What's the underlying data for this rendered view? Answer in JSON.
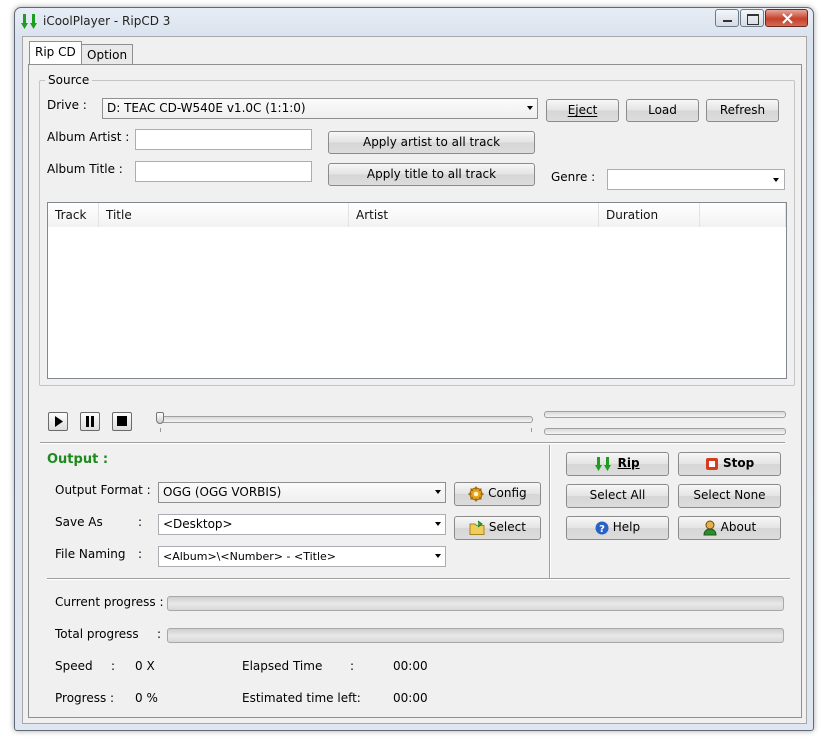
{
  "window": {
    "title": "iCoolPlayer - RipCD 3"
  },
  "tabs": [
    {
      "label": "Rip CD",
      "active": true
    },
    {
      "label": "Option",
      "active": false
    }
  ],
  "source": {
    "group_label": "Source",
    "drive_label": "Drive :",
    "drive_value": "D: TEAC CD-W540E v1.0C (1:1:0)",
    "eject_label": "Eject",
    "load_label": "Load",
    "refresh_label": "Refresh",
    "album_artist_label": "Album Artist :",
    "album_artist_value": "",
    "album_title_label": "Album Title :",
    "album_title_value": "",
    "apply_artist_label": "Apply artist to all track",
    "apply_title_label": "Apply title to all track",
    "genre_label": "Genre :",
    "genre_value": ""
  },
  "track_table": {
    "columns": [
      "Track",
      "Title",
      "Artist",
      "Duration"
    ],
    "rows": []
  },
  "output": {
    "heading": "Output :",
    "format_label": "Output Format :",
    "format_value": "OGG (OGG VORBIS)",
    "config_label": "Config",
    "save_as_label": "Save As",
    "save_as_value": "<Desktop>",
    "select_label": "Select",
    "file_naming_label": "File Naming",
    "file_naming_value": "<Album>\\<Number> - <Title>",
    "colon": ":"
  },
  "actions": {
    "rip": "Rip",
    "stop": "Stop",
    "select_all": "Select All",
    "select_none": "Select None",
    "help": "Help",
    "about": "About"
  },
  "status": {
    "current_progress_label": "Current progress :",
    "total_progress_label": "Total progress",
    "total_colon": ":",
    "speed_label": "Speed",
    "speed_colon": ":",
    "speed_value": "0 X",
    "elapsed_label": "Elapsed Time",
    "elapsed_colon": ":",
    "elapsed_value": "00:00",
    "progress_label": "Progress :",
    "progress_value": "0 %",
    "estimated_label": "Estimated time left:",
    "estimated_value": "00:00",
    "current_progress_fraction": 0,
    "total_progress_fraction": 0
  },
  "colors": {
    "output_heading": "#1d8a1d",
    "rip_arrow": "#1e9e1e",
    "stop_icon": "#d83a1e",
    "help_icon": "#2a62c4"
  }
}
